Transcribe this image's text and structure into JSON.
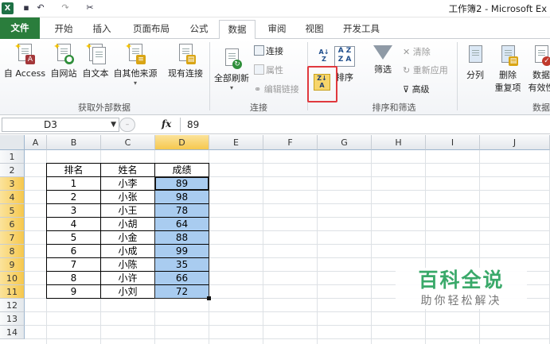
{
  "titlebar": {
    "logo": "X",
    "title": "工作簿2 - Microsoft Ex",
    "qa_icons": [
      "save-icon",
      "undo-icon",
      "redo-icon",
      "customize-icon"
    ]
  },
  "tabs": [
    {
      "label": "文件"
    },
    {
      "label": "开始"
    },
    {
      "label": "插入"
    },
    {
      "label": "页面布局"
    },
    {
      "label": "公式"
    },
    {
      "label": "数据"
    },
    {
      "label": "审阅"
    },
    {
      "label": "视图"
    },
    {
      "label": "开发工具"
    }
  ],
  "ribbon": {
    "get_external": {
      "access": "自 Access",
      "web": "自网站",
      "text": "自文本",
      "other": "自其他来源",
      "existing": "现有连接",
      "group": "获取外部数据"
    },
    "connections": {
      "refresh_all": "全部刷新",
      "connections": "连接",
      "properties": "属性",
      "edit_links": "编辑链接",
      "group": "连接"
    },
    "sort_filter": {
      "sort": "排序",
      "filter": "筛选",
      "clear": "清除",
      "reapply": "重新应用",
      "advanced": "高级",
      "group": "排序和筛选"
    },
    "data_tools": {
      "text_to_columns": "分列",
      "remove_dup_1": "删除",
      "remove_dup_2": "重复项",
      "validation_1": "数据",
      "validation_2": "有效性",
      "group": "数据"
    }
  },
  "formula_bar": {
    "name_box": "D3",
    "fx": "fx",
    "value": "89"
  },
  "grid": {
    "columns": [
      "A",
      "B",
      "C",
      "D",
      "E",
      "F",
      "G",
      "H",
      "I",
      "J"
    ],
    "rows": [
      "1",
      "2",
      "3",
      "4",
      "5",
      "6",
      "7",
      "8",
      "9",
      "10",
      "11",
      "12",
      "13",
      "14"
    ],
    "headers": [
      "排名",
      "姓名",
      "成绩"
    ],
    "data": [
      [
        "1",
        "小李",
        "89"
      ],
      [
        "2",
        "小张",
        "98"
      ],
      [
        "3",
        "小王",
        "78"
      ],
      [
        "4",
        "小胡",
        "64"
      ],
      [
        "5",
        "小金",
        "88"
      ],
      [
        "6",
        "小成",
        "99"
      ],
      [
        "7",
        "小陈",
        "35"
      ],
      [
        "8",
        "小许",
        "66"
      ],
      [
        "9",
        "小刘",
        "72"
      ]
    ]
  },
  "watermark": {
    "main": "百科全说",
    "sub": "助你轻松解决"
  }
}
